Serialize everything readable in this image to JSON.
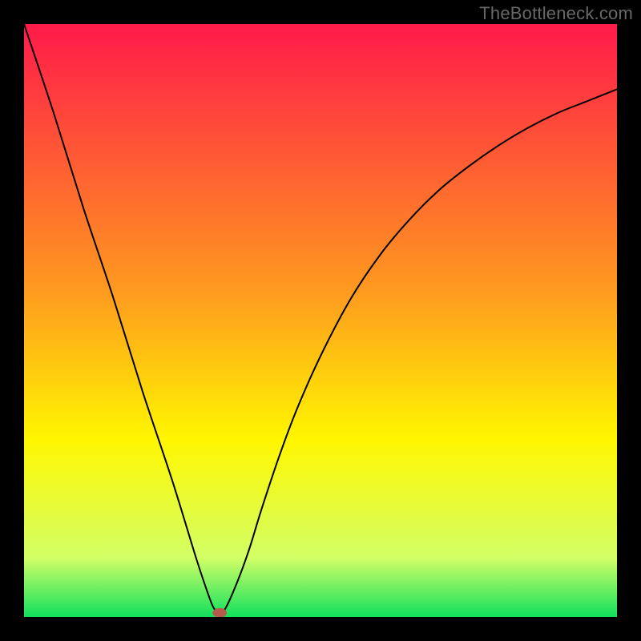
{
  "watermark": "TheBottleneck.com",
  "chart_data": {
    "type": "line",
    "title": "",
    "xlabel": "",
    "ylabel": "",
    "xlim": [
      0,
      100
    ],
    "ylim": [
      0,
      100
    ],
    "grid": false,
    "axes_visible": false,
    "background_gradient": {
      "stops": [
        {
          "offset": 0,
          "color": "#ff1a4a"
        },
        {
          "offset": 45,
          "color": "#ff9a1f"
        },
        {
          "offset": 70,
          "color": "#fff600"
        },
        {
          "offset": 90,
          "color": "#d3ff66"
        },
        {
          "offset": 100,
          "color": "#12e05e"
        }
      ]
    },
    "series": [
      {
        "name": "bottleneck-curve",
        "stroke": "#000000",
        "stroke_width": 2,
        "x": [
          0,
          5,
          10,
          15,
          20,
          25,
          29,
          31,
          32,
          33,
          34,
          36,
          38,
          40,
          43,
          46,
          50,
          55,
          60,
          65,
          70,
          75,
          80,
          85,
          90,
          95,
          100
        ],
        "values": [
          100,
          85,
          69,
          54,
          38,
          23,
          10,
          4,
          1.5,
          0.7,
          1.5,
          6,
          11.5,
          18,
          27,
          35,
          44,
          53.5,
          61,
          67,
          72,
          76,
          79.5,
          82.5,
          85,
          87,
          89
        ]
      }
    ],
    "marker": {
      "name": "optimal-point",
      "x": 33.0,
      "y": 0.7,
      "rx": 1.2,
      "ry": 0.8,
      "fill": "#b65a4c"
    }
  }
}
